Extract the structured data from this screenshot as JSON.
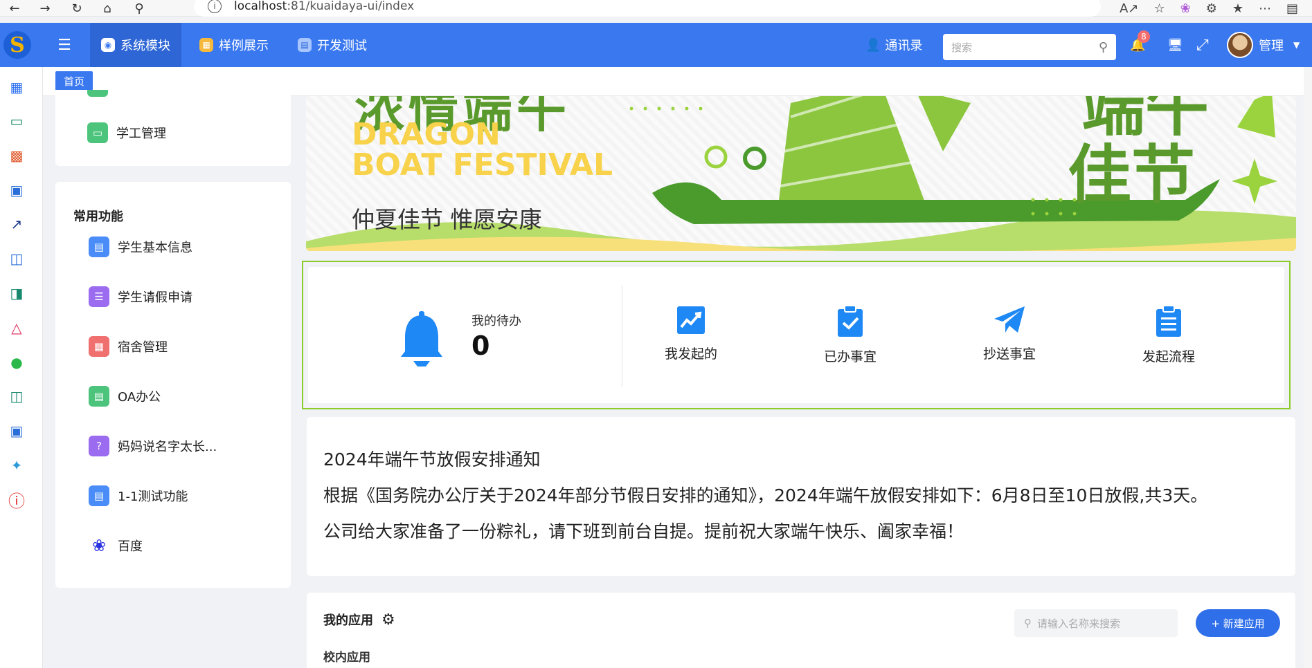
{
  "browser": {
    "url_host": "localhost",
    "url_rest": ":81/kuaidaya-ui/index"
  },
  "topnav": {
    "tabs": [
      {
        "label": "系统模块",
        "icon": "system-module-icon"
      },
      {
        "label": "样例展示",
        "icon": "sample-icon"
      },
      {
        "label": "开发测试",
        "icon": "dev-test-icon"
      }
    ],
    "contacts_label": "通讯录",
    "search_placeholder": "搜索",
    "notification_count": "8",
    "user_name": "管理"
  },
  "tags": {
    "home": "首页"
  },
  "sidebar": {
    "top_card_item": "学工管理",
    "common_title": "常用功能",
    "items": [
      {
        "label": "学生基本信息",
        "icon": "document-icon",
        "color": "#4a8df8"
      },
      {
        "label": "学生请假申请",
        "icon": "list-icon",
        "color": "#9b6cf0"
      },
      {
        "label": "宿舍管理",
        "icon": "dorm-icon",
        "color": "#f06f6f"
      },
      {
        "label": "OA办公",
        "icon": "oa-icon",
        "color": "#4cc47c"
      },
      {
        "label": "妈妈说名字太长...",
        "icon": "question-icon",
        "color": "#9b6cf0"
      },
      {
        "label": "1-1测试功能",
        "icon": "document-icon",
        "color": "#4a8df8"
      },
      {
        "label": "百度",
        "icon": "baidu-icon",
        "color": "#2932e1"
      }
    ]
  },
  "banner": {
    "title_cn": "浓情端午",
    "en_line1": "DRAGON",
    "en_line2": "BOAT FESTIVAL",
    "subtitle": "仲夏佳节 惟愿安康",
    "right_text_1": "端午",
    "right_text_2": "佳节"
  },
  "stats": {
    "todo_label": "我的待办",
    "todo_count": "0",
    "quick": [
      {
        "label": "我发起的",
        "icon": "chart-icon"
      },
      {
        "label": "已办事宜",
        "icon": "clipboard-check-icon"
      },
      {
        "label": "抄送事宜",
        "icon": "send-icon"
      },
      {
        "label": "发起流程",
        "icon": "clipboard-list-icon"
      }
    ]
  },
  "notice": {
    "title": "2024年端午节放假安排通知",
    "line1": "根据《国务院办公厅关于2024年部分节假日安排的通知》，2024年端午放假安排如下：6月8日至10日放假,共3天。",
    "line2": "公司给大家准备了一份粽礼，请下班到前台自提。提前祝大家端午快乐、阖家幸福！"
  },
  "apps": {
    "title": "我的应用",
    "subtitle": "校内应用",
    "search_placeholder": "请输入名称来搜索",
    "new_button": "+ 新建应用"
  }
}
